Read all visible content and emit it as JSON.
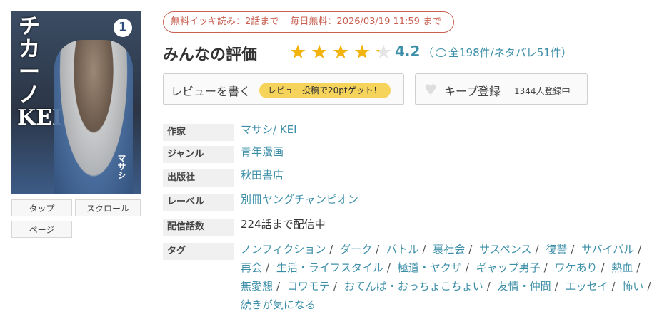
{
  "cover": {
    "title_vertical": "チカーノKEI",
    "volume": "1",
    "author": "マサシ"
  },
  "viewer_buttons": [
    "タップ",
    "スクロール",
    "ページ"
  ],
  "free_badge": {
    "bulk": "無料イッキ読み：2話まで",
    "daily": "毎日無料：2026/03/19 11:59 まで"
  },
  "rating": {
    "title": "みんなの評価",
    "score": "4.2",
    "score_value": 4.2,
    "max": 5,
    "counts": "全198件/ネタバレ51件",
    "paren_open": "（",
    "paren_close": "）"
  },
  "review_button": {
    "label": "レビューを書く",
    "pill": "レビュー投稿で20ptゲット！"
  },
  "keep_button": {
    "label": "キープ登録",
    "count": "1344人登録中"
  },
  "details": {
    "author_label": "作家",
    "authors": [
      "マサシ",
      "KEI"
    ],
    "author_sep": "/ ",
    "genre_label": "ジャンル",
    "genre": "青年漫画",
    "publisher_label": "出版社",
    "publisher": "秋田書店",
    "label_label": "レーベル",
    "label": "別冊ヤングチャンピオン",
    "episodes_label": "配信話数",
    "episodes": "224話まで配信中",
    "tags_label": "タグ"
  },
  "tags": [
    "ノンフィクション",
    "ダーク",
    "バトル",
    "裏社会",
    "サスペンス",
    "復讐",
    "サバイバル",
    "再会",
    "生活・ライフスタイル",
    "極道・ヤクザ",
    "ギャップ男子",
    "ワケあり",
    "熱血",
    "無愛想",
    "コワモテ",
    "おてんば・おっちょこちょい",
    "友情・仲間",
    "エッセイ",
    "怖い",
    "続きが気になる"
  ],
  "colors": {
    "link": "#3d8fa8",
    "star": "#f2b30c",
    "badge": "#c95f4f",
    "pill": "#f6d35b"
  }
}
